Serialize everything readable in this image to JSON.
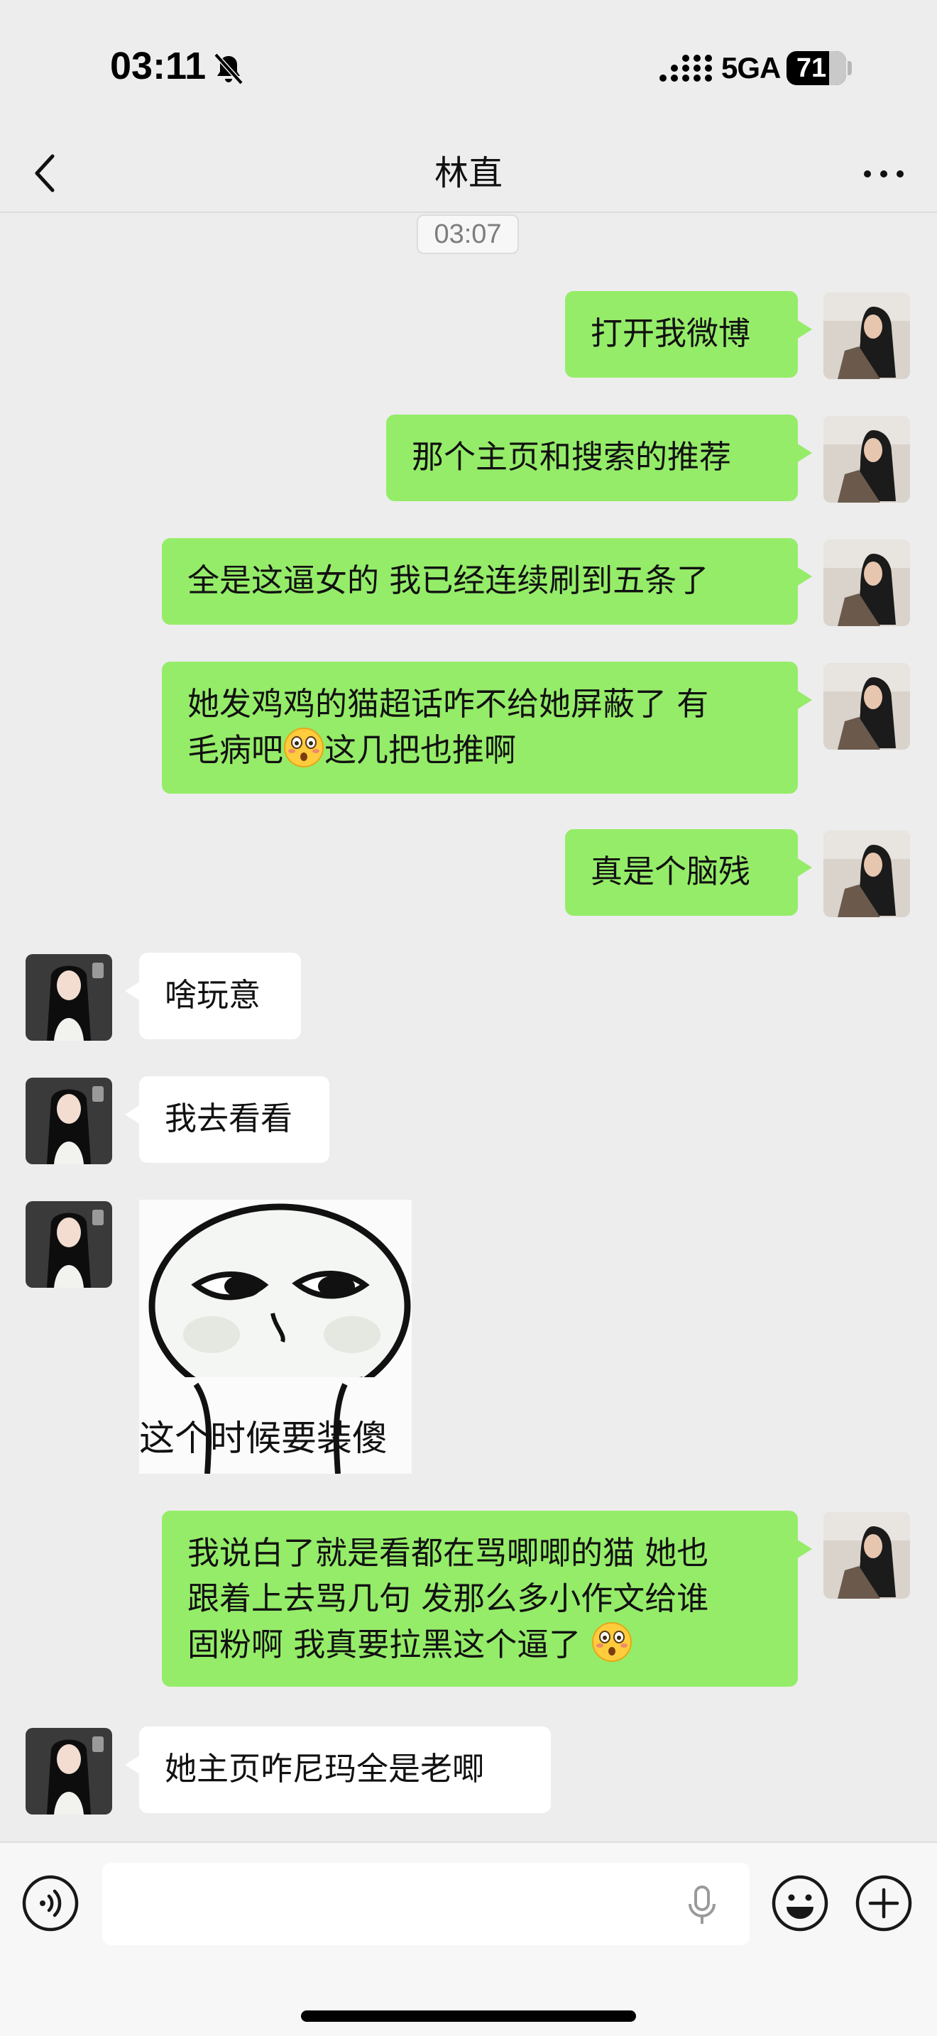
{
  "status_bar": {
    "time": "03:11",
    "network": "5GA",
    "battery_level": "71",
    "battery_fraction": 0.71
  },
  "header": {
    "title": "林直",
    "back_icon": "chevron-left-icon",
    "more_icon": "more-horizontal-icon"
  },
  "chat": {
    "timestamp": "03:07",
    "messages": [
      {
        "from": "me",
        "text": "打开我微博"
      },
      {
        "from": "me",
        "text": "那个主页和搜索的推荐"
      },
      {
        "from": "me",
        "text": "全是这逼女的 我已经连续刷到五条了"
      },
      {
        "from": "me",
        "text_line1": "她发鸡鸡的猫超话咋不给她屏蔽了 有",
        "text_line2_a": "毛病吧",
        "text_line2_b": "这几把也推啊",
        "emoji": "flushed-face-emoji"
      },
      {
        "from": "me",
        "text": "真是个脑残"
      },
      {
        "from": "them",
        "text": "啥玩意"
      },
      {
        "from": "them",
        "text": "我去看看"
      },
      {
        "from": "them",
        "sticker_caption": "这个时候要装傻"
      },
      {
        "from": "me",
        "text_line1": "我说白了就是看都在骂唧唧的猫 她也",
        "text_line2": "跟着上去骂几句 发那么多小作文给谁",
        "text_line3": "固粉啊 我真要拉黑这个逼了",
        "emoji": "flushed-face-emoji"
      },
      {
        "from": "them",
        "text": "她主页咋尼玛全是老唧"
      }
    ]
  },
  "input_bar": {
    "voice_icon": "voice-icon",
    "mic_icon": "microphone-icon",
    "emoji_icon": "smiley-icon",
    "plus_icon": "plus-circle-icon"
  },
  "colors": {
    "my_bubble": "#95ec69",
    "their_bubble": "#ffffff",
    "background": "#ededed"
  }
}
